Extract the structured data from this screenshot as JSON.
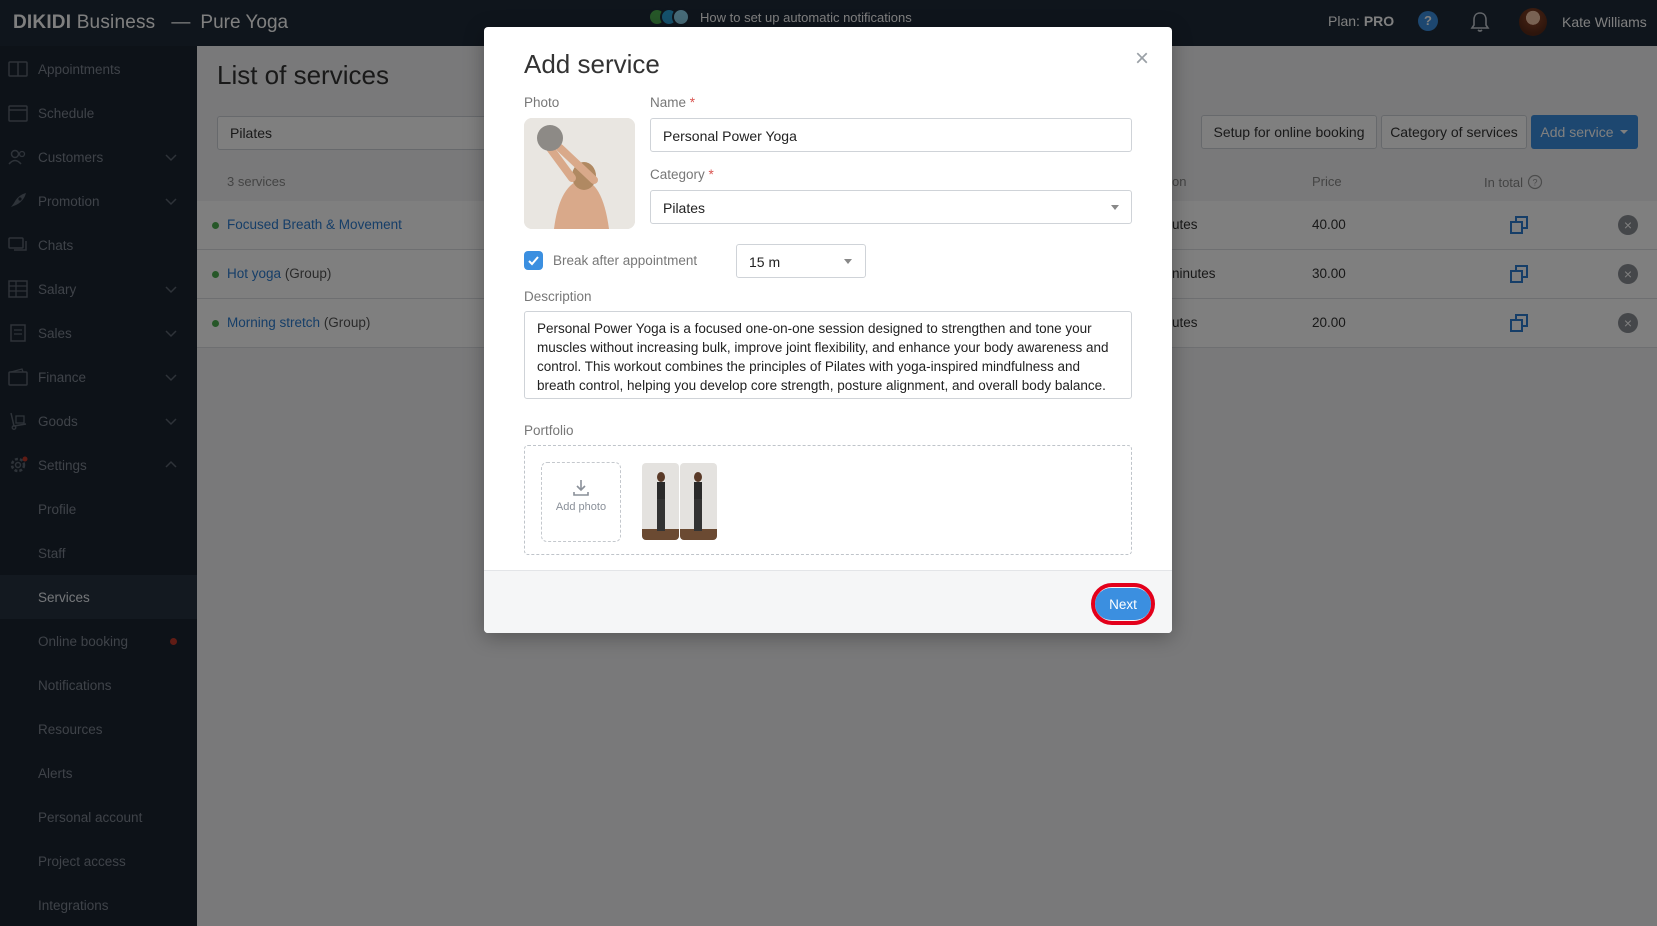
{
  "topbar": {
    "brand": "DIKIDI",
    "brand_suffix": "Business",
    "separator": "—",
    "project": "Pure Yoga",
    "promo": "How to set up automatic notifications",
    "plan_label": "Plan:",
    "plan_value": "PRO",
    "help": "?",
    "user_name": "Kate Williams"
  },
  "sidebar": {
    "items": [
      {
        "label": "Appointments"
      },
      {
        "label": "Schedule"
      },
      {
        "label": "Customers"
      },
      {
        "label": "Promotion"
      },
      {
        "label": "Chats"
      },
      {
        "label": "Salary"
      },
      {
        "label": "Sales"
      },
      {
        "label": "Finance"
      },
      {
        "label": "Goods"
      },
      {
        "label": "Settings"
      }
    ],
    "sub_items": [
      {
        "label": "Profile"
      },
      {
        "label": "Staff"
      },
      {
        "label": "Services"
      },
      {
        "label": "Online booking"
      },
      {
        "label": "Notifications"
      },
      {
        "label": "Resources"
      },
      {
        "label": "Alerts"
      },
      {
        "label": "Personal account"
      },
      {
        "label": "Project access"
      },
      {
        "label": "Integrations"
      }
    ]
  },
  "main": {
    "title": "List of services",
    "filter_value": "Pilates",
    "buttons": {
      "setup": "Setup for online booking",
      "category": "Category of services",
      "add": "Add service"
    },
    "count": "3 services",
    "columns": {
      "duration": "on",
      "price": "Price",
      "total": "In total"
    },
    "rows": [
      {
        "name": "Focused Breath & Movement",
        "group": "",
        "duration": "utes",
        "price": "40.00"
      },
      {
        "name": "Hot yoga",
        "group": "(Group)",
        "duration": "ninutes",
        "price": "30.00"
      },
      {
        "name": "Morning stretch",
        "group": "(Group)",
        "duration": "utes",
        "price": "20.00"
      }
    ]
  },
  "modal": {
    "title": "Add service",
    "close": "×",
    "photo_label": "Photo",
    "name_label": "Name",
    "name_value": "Personal Power Yoga",
    "category_label": "Category",
    "category_value": "Pilates",
    "break_label": "Break after appointment",
    "break_value": "15 m",
    "description_label": "Description",
    "description_value": "Personal Power Yoga is a focused one-on-one session designed to strengthen and tone your muscles without increasing bulk, improve joint flexibility, and enhance your body awareness and control. This workout combines the principles of Pilates with yoga-inspired mindfulness and breath control, helping you develop core strength, posture alignment, and overall body balance.",
    "portfolio_label": "Portfolio",
    "add_photo": "Add photo",
    "next": "Next",
    "required_mark": "*"
  },
  "colors": {
    "accent": "#3b8fe0",
    "highlight": "#e3001b",
    "sidebar": "#1a2430",
    "topbar": "#1e2a38"
  }
}
